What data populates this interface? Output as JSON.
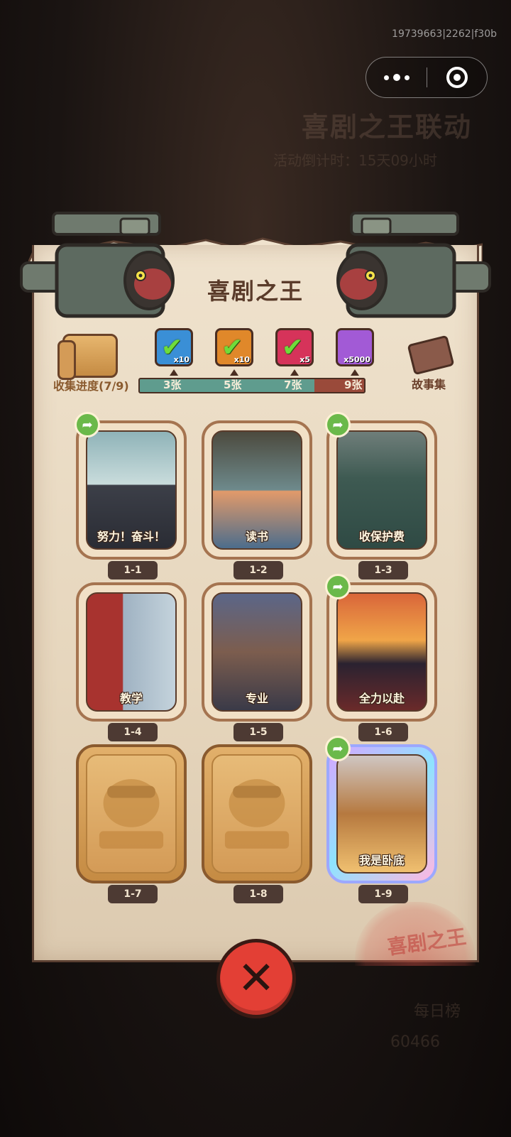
{
  "system": {
    "debug_id": "19739663|2262|f30b",
    "more_icon": "more-dots-icon",
    "close_icon": "target-close-icon"
  },
  "background": {
    "event_title": "喜剧之王联动",
    "countdown": "活动倒计时：15天09小时",
    "bottom_label": "每日榜",
    "bottom_score": "60466"
  },
  "panel": {
    "title": "喜剧之王",
    "collect_label": "收集进度(7/9)",
    "story_label": "故事集",
    "progress": {
      "collected": 7,
      "total": 9
    },
    "milestones": [
      {
        "label": "3张",
        "reward_qty": "x10",
        "claimed": true,
        "color": "#3a8fd6",
        "icon": "chest-icon"
      },
      {
        "label": "5张",
        "reward_qty": "x10",
        "claimed": true,
        "color": "#e0882a",
        "icon": "ticket-icon"
      },
      {
        "label": "7张",
        "reward_qty": "x5",
        "claimed": true,
        "color": "#d6335a",
        "icon": "orb-icon"
      },
      {
        "label": "9张",
        "reward_qty": "x5000",
        "claimed": false,
        "color": "#a25ad6",
        "icon": "crystal-icon"
      }
    ]
  },
  "cards": [
    {
      "id": "1-1",
      "caption": "努力！奋斗！",
      "unlocked": true,
      "shareable": true,
      "rare": false
    },
    {
      "id": "1-2",
      "caption": "读书",
      "unlocked": true,
      "shareable": false,
      "rare": false
    },
    {
      "id": "1-3",
      "caption": "收保护费",
      "unlocked": true,
      "shareable": true,
      "rare": false
    },
    {
      "id": "1-4",
      "caption": "教学",
      "unlocked": true,
      "shareable": false,
      "rare": false
    },
    {
      "id": "1-5",
      "caption": "专业",
      "unlocked": true,
      "shareable": false,
      "rare": false
    },
    {
      "id": "1-6",
      "caption": "全力以赴",
      "unlocked": true,
      "shareable": true,
      "rare": false
    },
    {
      "id": "1-7",
      "caption": "",
      "unlocked": false,
      "shareable": false,
      "rare": false
    },
    {
      "id": "1-8",
      "caption": "",
      "unlocked": false,
      "shareable": false,
      "rare": false
    },
    {
      "id": "1-9",
      "caption": "我是卧底",
      "unlocked": true,
      "shareable": true,
      "rare": true
    }
  ],
  "close_button": {
    "icon": "close-x-icon"
  },
  "stamp_text": "喜剧之王"
}
